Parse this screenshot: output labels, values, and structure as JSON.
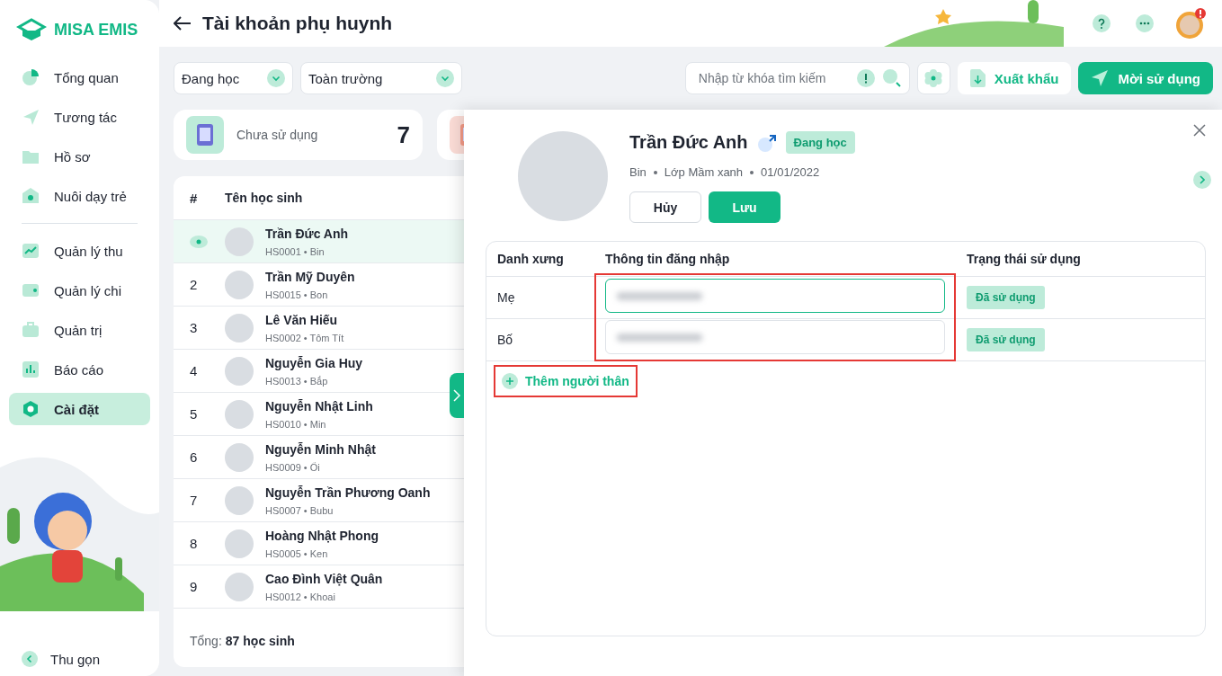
{
  "brand": "MISA EMIS",
  "sidebar": {
    "items": [
      {
        "label": "Tổng quan",
        "selected": false
      },
      {
        "label": "Tương tác",
        "selected": false
      },
      {
        "label": "Hồ sơ",
        "selected": false
      },
      {
        "label": "Nuôi dạy trẻ",
        "selected": false
      },
      {
        "label": "Quản lý thu",
        "selected": false
      },
      {
        "label": "Quản lý chi",
        "selected": false
      },
      {
        "label": "Quản trị",
        "selected": false
      },
      {
        "label": "Báo cáo",
        "selected": false
      },
      {
        "label": "Cài đặt",
        "selected": true
      }
    ],
    "collapse": "Thu gọn"
  },
  "page_title": "Tài khoản phụ huynh",
  "filters": [
    {
      "value": "Đang học"
    },
    {
      "value": "Toàn trường"
    }
  ],
  "search": {
    "placeholder": "Nhập từ khóa tìm kiếm"
  },
  "export_button": "Xuất khẩu",
  "invite_button": "Mời sử dụng",
  "stats": [
    {
      "label": "Chưa sử dụng",
      "value": "7",
      "kind": "unused"
    },
    {
      "kind": "used"
    }
  ],
  "table": {
    "columns": [
      "#",
      "Tên học sinh"
    ],
    "rows": [
      {
        "name": "Trần Đức Anh",
        "subtitle": "HS0001 • Bin",
        "selected": true
      },
      {
        "index": "2",
        "name": "Trần Mỹ Duyên",
        "subtitle": "HS0015 • Bon",
        "selected": false
      },
      {
        "index": "3",
        "name": "Lê Văn Hiếu",
        "subtitle": "HS0002 • Tôm Tít",
        "selected": false
      },
      {
        "index": "4",
        "name": "Nguyễn Gia Huy",
        "subtitle": "HS0013 • Bắp",
        "selected": false
      },
      {
        "index": "5",
        "name": "Nguyễn Nhật Linh",
        "subtitle": "HS0010 • Min",
        "selected": false
      },
      {
        "index": "6",
        "name": "Nguyễn Minh Nhật",
        "subtitle": "HS0009 • Ổi",
        "selected": false
      },
      {
        "index": "7",
        "name": "Nguyễn Trần Phương Oanh",
        "subtitle": "HS0007 • Bubu",
        "selected": false
      },
      {
        "index": "8",
        "name": "Hoàng Nhật Phong",
        "subtitle": "HS0005 • Ken",
        "selected": false
      },
      {
        "index": "9",
        "name": "Cao Đình Việt Quân",
        "subtitle": "HS0012 • Khoai",
        "selected": false
      }
    ],
    "total_label": "Tổng:",
    "total_value": "87 học sinh"
  },
  "detail": {
    "name": "Trần Đức Anh",
    "status": "Đang học",
    "meta": [
      "Bin",
      "Lớp Mầm xanh",
      "01/01/2022"
    ],
    "cancel_button": "Hủy",
    "save_button": "Lưu",
    "columns": [
      "Danh xưng",
      "Thông tin đăng nhập",
      "Trạng thái sử dụng"
    ],
    "login_highlighted": true,
    "relatives": [
      {
        "relation": "Mẹ",
        "focused": true,
        "status": "Đã sử dụng"
      },
      {
        "relation": "Bố",
        "focused": false,
        "status": "Đã sử dụng"
      }
    ],
    "add_relative": {
      "label": "Thêm người thân",
      "highlighted": true
    }
  }
}
